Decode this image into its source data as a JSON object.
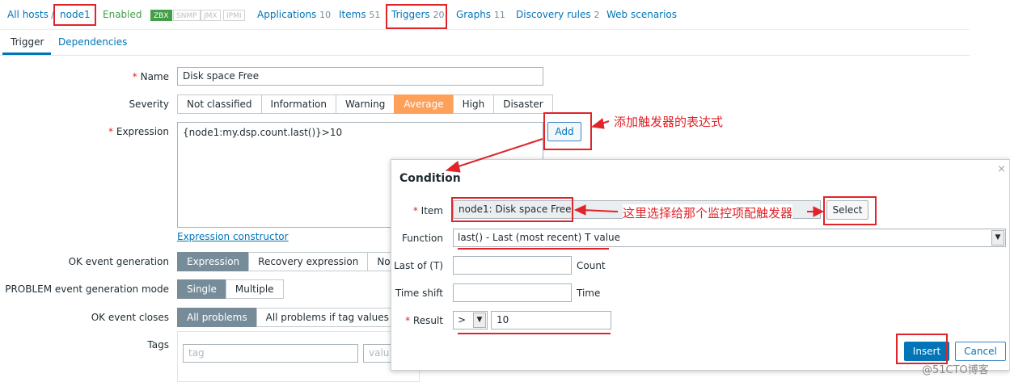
{
  "nav": {
    "all_hosts": "All hosts",
    "separator": "/",
    "host": "node1",
    "enabled": "Enabled",
    "tags": [
      "ZBX",
      "SNMP",
      "JMX",
      "IPMI"
    ],
    "applications": {
      "label": "Applications",
      "count": "10"
    },
    "items": {
      "label": "Items",
      "count": "51"
    },
    "triggers": {
      "label": "Triggers",
      "count": "20"
    },
    "graphs": {
      "label": "Graphs",
      "count": "11"
    },
    "discovery": {
      "label": "Discovery rules",
      "count": "2"
    },
    "web": {
      "label": "Web scenarios"
    }
  },
  "tabs": [
    "Trigger",
    "Dependencies"
  ],
  "form": {
    "name_label": "Name",
    "name_value": "Disk space Free",
    "severity_label": "Severity",
    "severity_options": [
      "Not classified",
      "Information",
      "Warning",
      "Average",
      "High",
      "Disaster"
    ],
    "severity_selected": "Average",
    "expression_label": "Expression",
    "expression_value": "{node1:my.dsp.count.last()}>10",
    "add_button": "Add",
    "expression_constructor": "Expression constructor",
    "ok_event_generation_label": "OK event generation",
    "ok_event_generation_options": [
      "Expression",
      "Recovery expression",
      "Non"
    ],
    "problem_mode_label": "PROBLEM event generation mode",
    "problem_mode_options": [
      "Single",
      "Multiple"
    ],
    "ok_event_closes_label": "OK event closes",
    "ok_event_closes_options": [
      "All problems",
      "All problems if tag values ma"
    ],
    "tags_label": "Tags",
    "tag_placeholder": "tag",
    "value_placeholder": "valu"
  },
  "dialog": {
    "title": "Condition",
    "close": "×",
    "item_label": "Item",
    "item_value": "node1: Disk space Free",
    "select_button": "Select",
    "function_label": "Function",
    "function_value": "last() - Last (most recent) T value",
    "last_of_label": "Last of (T)",
    "last_of_unit": "Count",
    "time_shift_label": "Time shift",
    "time_shift_unit": "Time",
    "result_label": "Result",
    "result_operator": ">",
    "result_value": "10",
    "insert_button": "Insert",
    "cancel_button": "Cancel"
  },
  "annotations": {
    "add_trigger_expression": "添加触发器的表达式",
    "select_item": "这里选择给那个监控项配触发器",
    "watermark": "@51CTO博客"
  },
  "colors": {
    "accent": "#0275b8",
    "annotation_red": "#e0242a",
    "selected_segment": "#768d99",
    "average_orange": "#ffa059",
    "insert_blue": "#0275b8"
  }
}
